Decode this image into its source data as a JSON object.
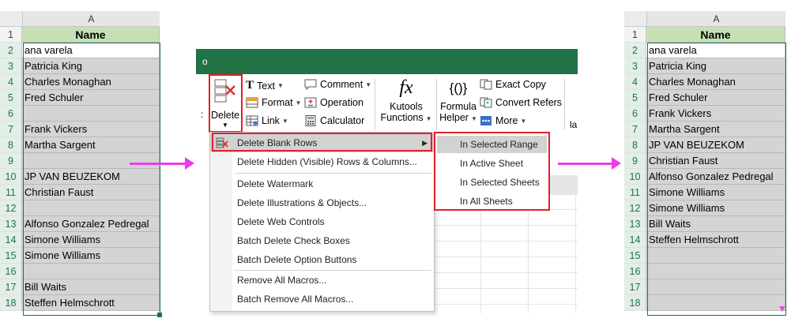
{
  "left_sheet": {
    "column_letter": "A",
    "header": "Name",
    "rows": [
      {
        "n": "1",
        "v": "Name"
      },
      {
        "n": "2",
        "v": "ana varela"
      },
      {
        "n": "3",
        "v": "Patricia King"
      },
      {
        "n": "4",
        "v": "Charles Monaghan"
      },
      {
        "n": "5",
        "v": "Fred Schuler"
      },
      {
        "n": "6",
        "v": ""
      },
      {
        "n": "7",
        "v": "Frank Vickers"
      },
      {
        "n": "8",
        "v": "Martha Sargent"
      },
      {
        "n": "9",
        "v": ""
      },
      {
        "n": "10",
        "v": "JP VAN BEUZEKOM"
      },
      {
        "n": "11",
        "v": "Christian Faust"
      },
      {
        "n": "12",
        "v": ""
      },
      {
        "n": "13",
        "v": "Alfonso Gonzalez Pedregal"
      },
      {
        "n": "14",
        "v": "Simone Williams"
      },
      {
        "n": "15",
        "v": "Simone Williams"
      },
      {
        "n": "16",
        "v": ""
      },
      {
        "n": "17",
        "v": "Bill Waits"
      },
      {
        "n": "18",
        "v": "Steffen Helmschrott"
      }
    ]
  },
  "right_sheet": {
    "column_letter": "A",
    "header": "Name",
    "rows": [
      {
        "n": "1",
        "v": "Name"
      },
      {
        "n": "2",
        "v": "ana varela"
      },
      {
        "n": "3",
        "v": "Patricia King"
      },
      {
        "n": "4",
        "v": "Charles Monaghan"
      },
      {
        "n": "5",
        "v": "Fred Schuler"
      },
      {
        "n": "6",
        "v": "Frank Vickers"
      },
      {
        "n": "7",
        "v": "Martha Sargent"
      },
      {
        "n": "8",
        "v": "JP VAN BEUZEKOM"
      },
      {
        "n": "9",
        "v": "Christian Faust"
      },
      {
        "n": "10",
        "v": "Alfonso Gonzalez Pedregal"
      },
      {
        "n": "11",
        "v": "Simone Williams"
      },
      {
        "n": "12",
        "v": "Simone Williams"
      },
      {
        "n": "13",
        "v": "Bill Waits"
      },
      {
        "n": "14",
        "v": "Steffen Helmschrott"
      },
      {
        "n": "15",
        "v": ""
      },
      {
        "n": "16",
        "v": ""
      },
      {
        "n": "17",
        "v": ""
      },
      {
        "n": "18",
        "v": ""
      }
    ]
  },
  "ribbon": {
    "title_fragment": "o",
    "delete": "Delete",
    "text": "Text",
    "format": "Format",
    "link": "Link",
    "comment": "Comment",
    "operation": "Operation",
    "calculator": "Calculator",
    "kutools_line1": "Kutools",
    "kutools_line2": "Functions",
    "fx": "fx",
    "formula_icon": "{()}",
    "formula_line1": "Formula",
    "formula_line2": "Helper",
    "exact_copy": "Exact Copy",
    "convert_refers": "Convert Refers",
    "more": "More",
    "cut_label": "la",
    "left_fragment": ":"
  },
  "menu": {
    "items": [
      "Delete Blank Rows",
      "Delete Hidden (Visible) Rows & Columns...",
      "Delete Watermark",
      "Delete Illustrations & Objects...",
      "Delete Web Controls",
      "Batch Delete Check Boxes",
      "Batch Delete Option Buttons",
      "Remove All Macros...",
      "Batch Remove All Macros..."
    ]
  },
  "submenu": {
    "items": [
      "In Selected Range",
      "In Active Sheet",
      "In Selected Sheets",
      "In All Sheets"
    ]
  },
  "colors": {
    "excel_green": "#217346",
    "header_fill": "#c6e0b4",
    "highlight_red": "#e0202c",
    "arrow": "#e83ee8"
  }
}
